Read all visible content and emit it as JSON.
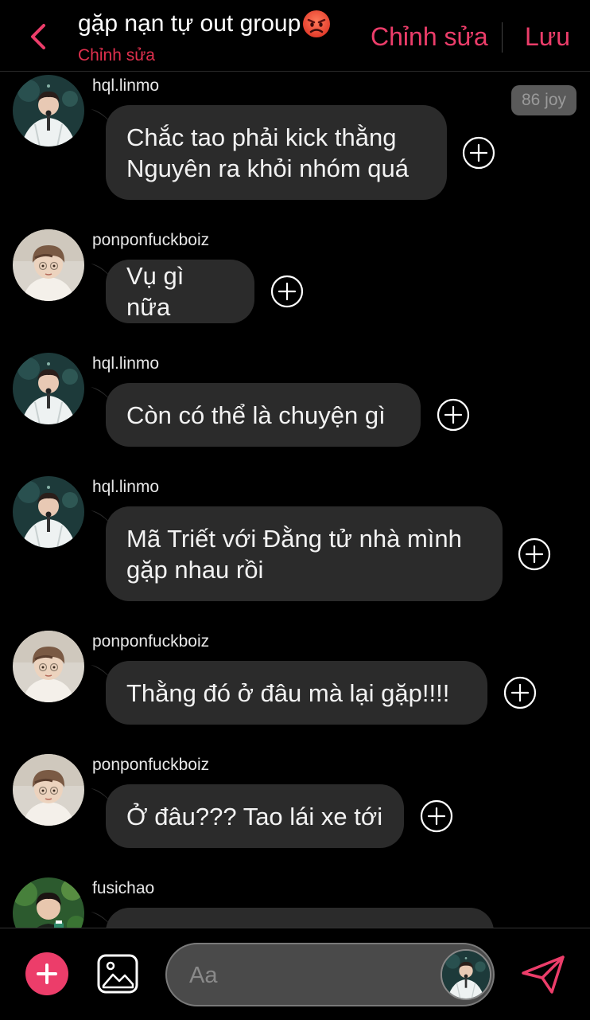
{
  "header": {
    "title": "gặp nạn tự out group",
    "subtitle": "Chỉnh sửa",
    "edit_label": "Chỉnh sửa",
    "save_label": "Lưu"
  },
  "badge": {
    "label": "86 joy"
  },
  "messages": [
    {
      "user": "hql.linmo",
      "avatar": "avatar-linmo",
      "text": "Chắc tao phải kick thằng Nguyên ra khỏi nhóm quá"
    },
    {
      "user": "ponponfuckboiz",
      "avatar": "avatar-ponpon",
      "text": "Vụ gì nữa"
    },
    {
      "user": "hql.linmo",
      "avatar": "avatar-linmo",
      "text": "Còn có thể là chuyện gì"
    },
    {
      "user": "hql.linmo",
      "avatar": "avatar-linmo",
      "text": "Mã Triết với Đằng tử nhà mình gặp nhau rồi"
    },
    {
      "user": "ponponfuckboiz",
      "avatar": "avatar-ponpon",
      "text": "Thằng đó ở đâu mà lại gặp!!!!"
    },
    {
      "user": "ponponfuckboiz",
      "avatar": "avatar-ponpon",
      "text": "Ở đâu??? Tao lái xe tới"
    },
    {
      "user": "fusichao",
      "avatar": "avatar-fusichao",
      "text": ""
    }
  ],
  "composer": {
    "placeholder": "Aa"
  },
  "colors": {
    "accent": "#ec3d6a",
    "bubble": "#2b2b2b",
    "background": "#000000"
  },
  "icons": {
    "back": "chevron-left-icon",
    "add_reaction": "plus-circle-icon",
    "plus": "plus-icon",
    "gallery": "image-icon",
    "send": "send-icon"
  }
}
